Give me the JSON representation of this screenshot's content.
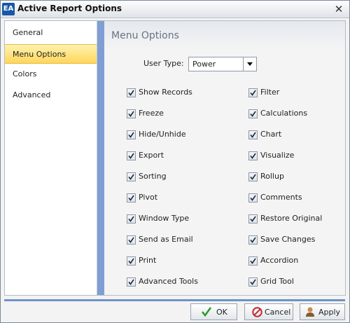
{
  "window": {
    "title": "Active Report Options",
    "app_icon_text": "EA",
    "close_glyph": "✕"
  },
  "nav": {
    "items": [
      {
        "label": "General",
        "selected": false
      },
      {
        "label": "Menu Options",
        "selected": true
      },
      {
        "label": "Colors",
        "selected": false
      },
      {
        "label": "Advanced",
        "selected": false
      }
    ]
  },
  "content": {
    "section_title": "Menu Options",
    "user_type": {
      "label": "User Type:",
      "value": "Power"
    },
    "left_options": [
      {
        "label": "Show Records",
        "checked": true
      },
      {
        "label": "Freeze",
        "checked": true
      },
      {
        "label": "Hide/Unhide",
        "checked": true
      },
      {
        "label": "Export",
        "checked": true
      },
      {
        "label": "Sorting",
        "checked": true
      },
      {
        "label": "Pivot",
        "checked": true
      },
      {
        "label": "Window Type",
        "checked": true
      },
      {
        "label": "Send as Email",
        "checked": true
      },
      {
        "label": "Print",
        "checked": true
      },
      {
        "label": "Advanced Tools",
        "checked": true
      }
    ],
    "right_options": [
      {
        "label": "Filter",
        "checked": true
      },
      {
        "label": "Calculations",
        "checked": true
      },
      {
        "label": "Chart",
        "checked": true
      },
      {
        "label": "Visualize",
        "checked": true
      },
      {
        "label": "Rollup",
        "checked": true
      },
      {
        "label": "Comments",
        "checked": true
      },
      {
        "label": "Restore Original",
        "checked": true
      },
      {
        "label": "Save Changes",
        "checked": true
      },
      {
        "label": "Accordion",
        "checked": true
      },
      {
        "label": "Grid Tool",
        "checked": true
      }
    ]
  },
  "buttons": {
    "ok": "OK",
    "cancel": "Cancel",
    "apply": "Apply"
  },
  "colors": {
    "accent_blue": "#6f93c9",
    "selection_yellow": "#ffd65a",
    "ok_green": "#2e9a2e",
    "cancel_red": "#c8282d"
  }
}
